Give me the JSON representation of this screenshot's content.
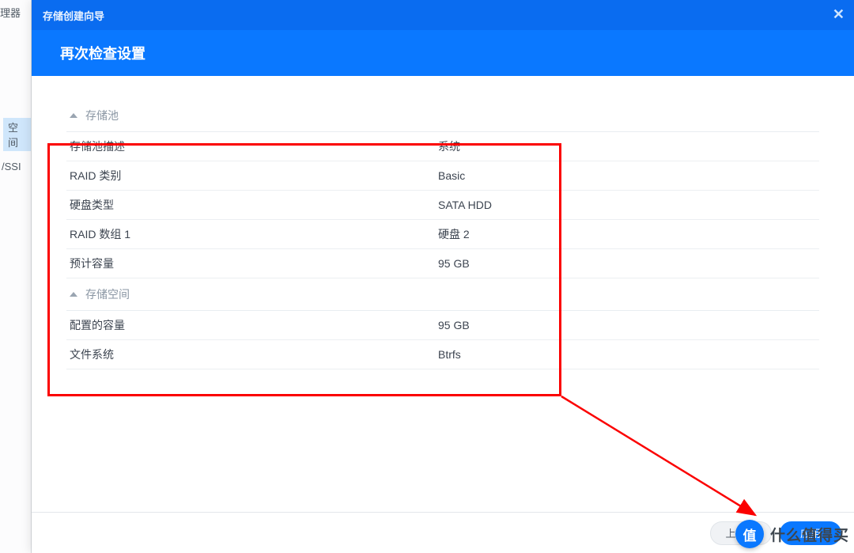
{
  "sidebar": {
    "frag_top": "理器",
    "frag_mid": "空间",
    "frag_bot": "/SSI"
  },
  "modal": {
    "title": "存储创建向导",
    "heading": "再次检查设置"
  },
  "sections": [
    {
      "title": "存储池",
      "rows": [
        {
          "label": "存储池描述",
          "value": "系统"
        },
        {
          "label": "RAID 类别",
          "value": "Basic"
        },
        {
          "label": "硬盘类型",
          "value": "SATA HDD"
        },
        {
          "label": "RAID 数组 1",
          "value": "硬盘 2"
        },
        {
          "label": "预计容量",
          "value": "95 GB"
        }
      ]
    },
    {
      "title": "存储空间",
      "rows": [
        {
          "label": "配置的容量",
          "value": "95 GB"
        },
        {
          "label": "文件系统",
          "value": "Btrfs"
        }
      ]
    }
  ],
  "buttons": {
    "back": "上一步",
    "apply": "应用"
  },
  "watermark": {
    "icon_text": "值",
    "text": "什么值得买"
  }
}
